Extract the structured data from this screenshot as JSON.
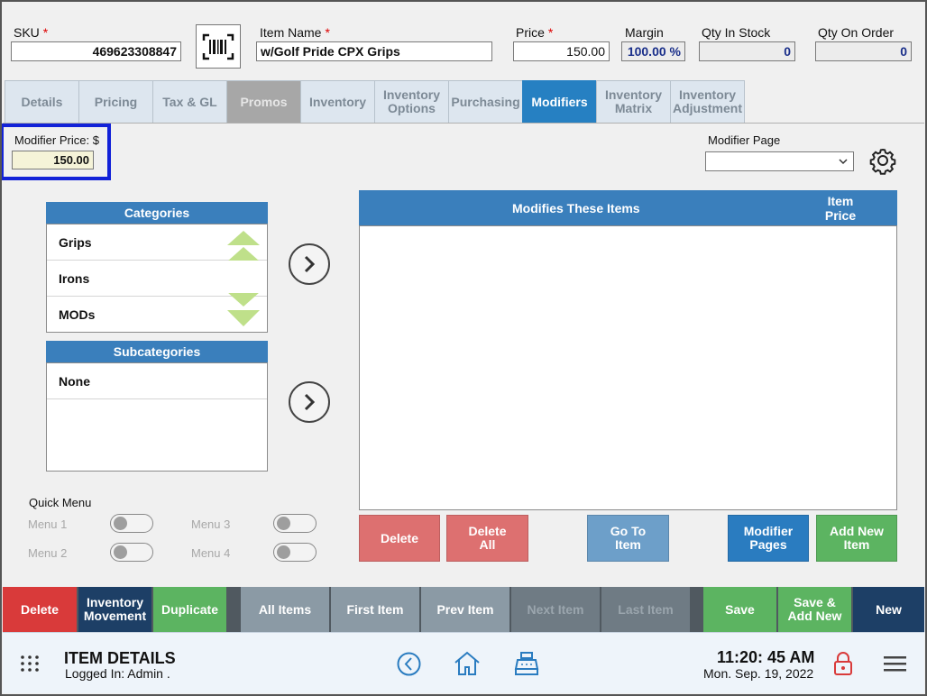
{
  "header": {
    "sku_label": "SKU",
    "sku_value": "469623308847",
    "item_name_label": "Item Name",
    "item_name_value": "w/Golf Pride CPX Grips",
    "price_label": "Price",
    "price_value": "150.00",
    "margin_label": "Margin",
    "margin_value": "100.00 %",
    "qty_stock_label": "Qty In Stock",
    "qty_stock_value": "0",
    "qty_order_label": "Qty On Order",
    "qty_order_value": "0",
    "required_mark": "*"
  },
  "tabs": [
    {
      "label": "Details"
    },
    {
      "label": "Pricing"
    },
    {
      "label": "Tax & GL"
    },
    {
      "label": "Promos"
    },
    {
      "label": "Inventory"
    },
    {
      "label": "Inventory Options"
    },
    {
      "label": "Purchasing"
    },
    {
      "label": "Modifiers"
    },
    {
      "label": "Inventory Matrix"
    },
    {
      "label": "Inventory Adjustment"
    }
  ],
  "modifier_price": {
    "label": "Modifier Price: $",
    "value": "150.00"
  },
  "modifier_page": {
    "label": "Modifier Page",
    "value": ""
  },
  "categories": {
    "title": "Categories",
    "items": [
      "Grips",
      "Irons",
      "MODs"
    ]
  },
  "subcategories": {
    "title": "Subcategories",
    "items": [
      "None"
    ]
  },
  "modifies_table": {
    "col_items": "Modifies These Items",
    "col_price": "Item Price"
  },
  "actions": {
    "delete": "Delete",
    "delete_all": "Delete All",
    "go_to_item": "Go To Item",
    "modifier_pages": "Modifier Pages",
    "add_new_item": "Add New Item"
  },
  "quick_menu": {
    "title": "Quick Menu",
    "items": [
      "Menu 1",
      "Menu 2",
      "Menu 3",
      "Menu 4"
    ]
  },
  "bottom_bar": {
    "delete": "Delete",
    "inventory_movement": "Inventory Movement",
    "duplicate": "Duplicate",
    "all_items": "All Items",
    "first_item": "First Item",
    "prev_item": "Prev Item",
    "next_item": "Next Item",
    "last_item": "Last Item",
    "save": "Save",
    "save_add_new": "Save & Add New",
    "new": "New"
  },
  "footer": {
    "title": "ITEM DETAILS",
    "logged_in": "Logged In:  Admin .",
    "time": "11:20: 45 AM",
    "date": "Mon. Sep. 19, 2022"
  },
  "colors": {
    "accent": "#2680c2",
    "panel_header": "#3a7fbc",
    "delete_red": "#d93a3a",
    "action_red": "#dd7070",
    "action_blue_light": "#6d9fc9",
    "action_blue": "#2a7cc0",
    "action_green": "#5cb461",
    "nav_grey": "#8b9aa5",
    "highlight_border": "#1222d8"
  }
}
